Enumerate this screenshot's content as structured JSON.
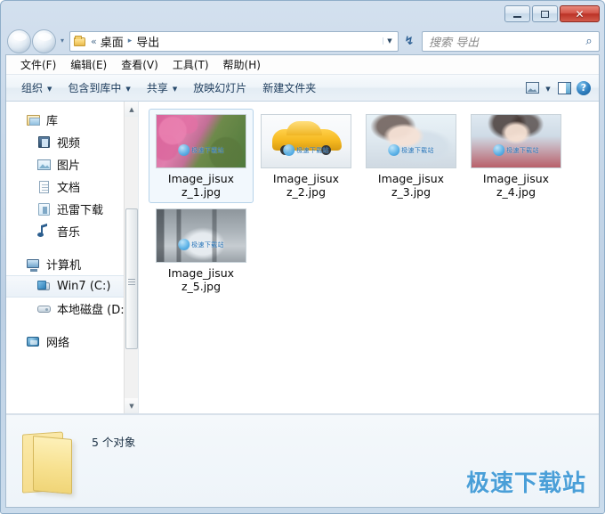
{
  "window": {
    "controls": {
      "minimize": "—",
      "maximize": "□",
      "close": "✕"
    }
  },
  "address": {
    "folder_icon": "folder-icon",
    "chevron": "«",
    "separator": "▸",
    "crumb_root": "桌面",
    "crumb_current": "导出",
    "dropdown": "▼",
    "refresh": "↻"
  },
  "search": {
    "placeholder": "搜索 导出",
    "icon": "search-icon"
  },
  "menubar": {
    "items": [
      {
        "label": "文件(F)"
      },
      {
        "label": "编辑(E)"
      },
      {
        "label": "查看(V)"
      },
      {
        "label": "工具(T)"
      },
      {
        "label": "帮助(H)"
      }
    ]
  },
  "toolbar": {
    "organize": "组织",
    "include_in_library": "包含到库中",
    "share": "共享",
    "slideshow": "放映幻灯片",
    "new_folder": "新建文件夹",
    "caret": "▼",
    "help_glyph": "?"
  },
  "navpane": {
    "items": [
      {
        "label": "库",
        "icon": "library-icon",
        "level": "root",
        "selected": false
      },
      {
        "label": "视频",
        "icon": "video-icon",
        "level": "child",
        "selected": false
      },
      {
        "label": "图片",
        "icon": "picture-icon",
        "level": "child",
        "selected": false
      },
      {
        "label": "文档",
        "icon": "document-icon",
        "level": "child",
        "selected": false
      },
      {
        "label": "迅雷下载",
        "icon": "download-icon",
        "level": "child",
        "selected": false
      },
      {
        "label": "音乐",
        "icon": "music-icon",
        "level": "child",
        "selected": false
      },
      {
        "label": "计算机",
        "icon": "computer-icon",
        "level": "root",
        "selected": false
      },
      {
        "label": "Win7 (C:)",
        "icon": "harddisk-icon",
        "level": "child",
        "selected": true
      },
      {
        "label": "本地磁盘 (D:",
        "icon": "disk-icon",
        "level": "child",
        "selected": false
      },
      {
        "label": "网络",
        "icon": "network-icon",
        "level": "root",
        "selected": false
      }
    ],
    "scroll": {
      "up_arrow": "▲",
      "down_arrow": "▼"
    }
  },
  "files": {
    "items": [
      {
        "name_line1": "Image_jisux",
        "name_line2": "z_1.jpg",
        "thumb": "t1",
        "selected": true
      },
      {
        "name_line1": "Image_jisux",
        "name_line2": "z_2.jpg",
        "thumb": "t2",
        "selected": false
      },
      {
        "name_line1": "Image_jisux",
        "name_line2": "z_3.jpg",
        "thumb": "t3",
        "selected": false
      },
      {
        "name_line1": "Image_jisux",
        "name_line2": "z_4.jpg",
        "thumb": "t4",
        "selected": false
      },
      {
        "name_line1": "Image_jisux",
        "name_line2": "z_5.jpg",
        "thumb": "t5",
        "selected": false
      }
    ],
    "thumb_watermark": "极速下载站"
  },
  "statusbar": {
    "count_text": "5 个对象",
    "folder_icon": "folder-large-icon"
  },
  "watermark": {
    "text": "极速下载站",
    "color": "#4a9fd8"
  }
}
